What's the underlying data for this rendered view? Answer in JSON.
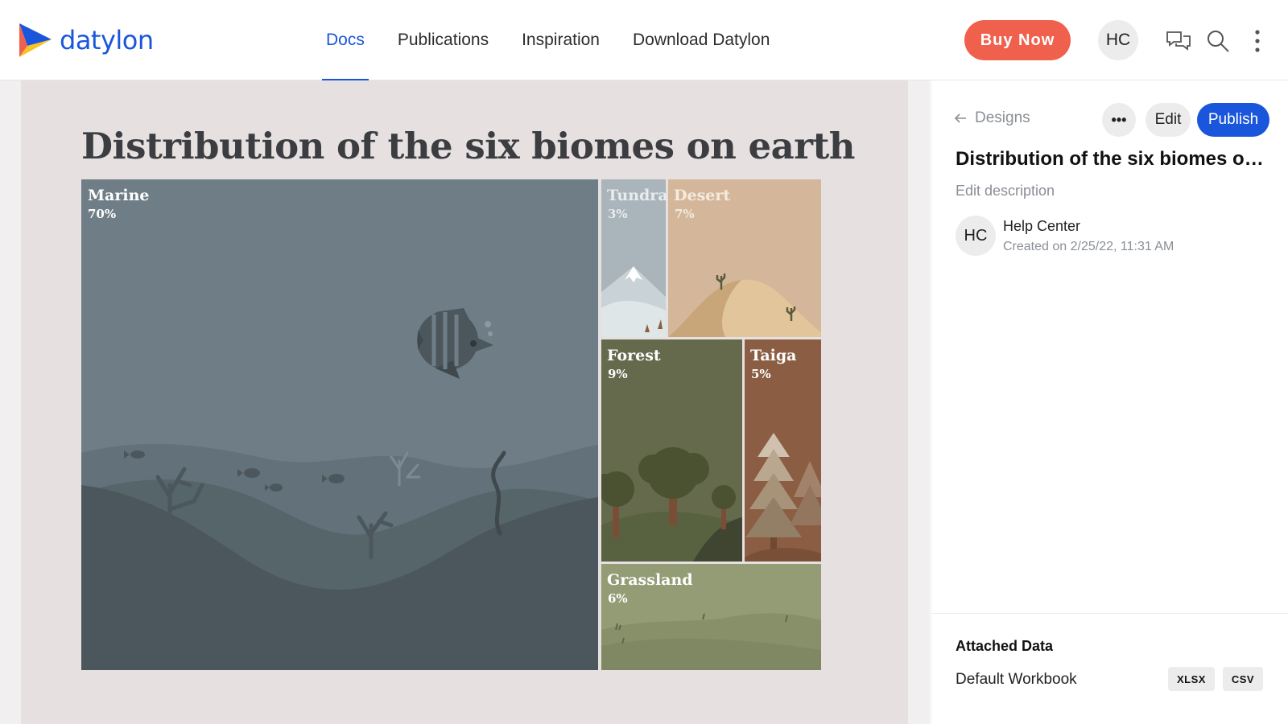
{
  "header": {
    "logo_text": "datylon",
    "nav": [
      {
        "label": "Docs",
        "active": true
      },
      {
        "label": "Publications",
        "active": false
      },
      {
        "label": "Inspiration",
        "active": false
      },
      {
        "label": "Download Datylon",
        "active": false
      }
    ],
    "buy_label": "Buy Now",
    "avatar_initials": "HC",
    "icons": [
      "chat-icon",
      "search-icon",
      "more-vertical-icon"
    ]
  },
  "colors": {
    "brand_blue": "#1a56db",
    "buy_red": "#f0614d",
    "marine": "#6f7e86",
    "tundra": "#aab5bb",
    "desert": "#d4b79a",
    "forest": "#656a4c",
    "taiga": "#8b5d42",
    "grassland": "#939c74"
  },
  "chart": {
    "title": "Distribution of the six biomes on earth"
  },
  "chart_data": {
    "type": "treemap",
    "title": "Distribution of the six biomes on earth",
    "items": [
      {
        "name": "Marine",
        "value": 70,
        "label": "70%"
      },
      {
        "name": "Tundra",
        "value": 3,
        "label": "3%"
      },
      {
        "name": "Desert",
        "value": 7,
        "label": "7%"
      },
      {
        "name": "Forest",
        "value": 9,
        "label": "9%"
      },
      {
        "name": "Taiga",
        "value": 5,
        "label": "5%"
      },
      {
        "name": "Grassland",
        "value": 6,
        "label": "6%"
      }
    ]
  },
  "panel": {
    "back_label": "Designs",
    "more_label": "•••",
    "edit_label": "Edit",
    "publish_label": "Publish",
    "doc_title": "Distribution of the six biomes on earth",
    "edit_description": "Edit description",
    "author_initials": "HC",
    "author_name": "Help Center",
    "created": "Created on 2/25/22, 11:31 AM",
    "attached_title": "Attached Data",
    "workbook_name": "Default Workbook",
    "formats": [
      "XLSX",
      "CSV"
    ]
  }
}
